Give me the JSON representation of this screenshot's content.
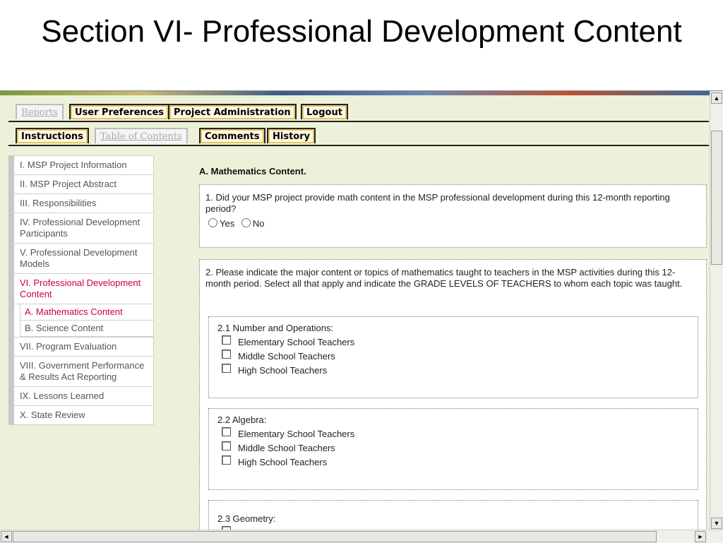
{
  "slide_title": "Section VI- Professional Development Content",
  "top_tabs": [
    {
      "label": "Reports",
      "state": "disabled"
    },
    {
      "label": "User Preferences",
      "state": "normal"
    },
    {
      "label": "Project Administration",
      "state": "normal"
    },
    {
      "label": "Logout",
      "state": "normal"
    }
  ],
  "sub_tabs": [
    {
      "label": "Instructions",
      "state": "normal"
    },
    {
      "label": "Table of Contents",
      "state": "disabled"
    },
    {
      "label": "Comments",
      "state": "normal"
    },
    {
      "label": "History",
      "state": "normal"
    }
  ],
  "nav": {
    "items": [
      {
        "label": "I. MSP Project Information"
      },
      {
        "label": "II. MSP Project Abstract"
      },
      {
        "label": "III. Responsibilities"
      },
      {
        "label": "IV. Professional Development Participants"
      },
      {
        "label": "V. Professional Development Models"
      },
      {
        "label": "VI. Professional Development Content",
        "active": true
      },
      {
        "label": "VII. Program Evaluation"
      },
      {
        "label": "VIII. Government Performance & Results Act Reporting"
      },
      {
        "label": "IX. Lessons Learned"
      },
      {
        "label": "X. State Review"
      }
    ],
    "subitems": [
      {
        "label": "A. Mathematics Content",
        "active": true
      },
      {
        "label": "B. Science Content"
      }
    ]
  },
  "main": {
    "section_heading": "A.   Mathematics Content.",
    "q1": {
      "text": "1. Did your MSP project provide math content in the MSP professional development during this 12-month reporting period?",
      "options": [
        "Yes",
        "No"
      ]
    },
    "q2": {
      "text": "2. Please indicate the major content or topics of mathematics taught to teachers in the MSP activities during this 12-month period. Select all that apply and indicate the GRADE LEVELS OF TEACHERS to whom each topic was taught.",
      "subsections": [
        {
          "title": "2.1 Number and Operations:",
          "options": [
            "Elementary School Teachers",
            "Middle School Teachers",
            "High School Teachers"
          ]
        },
        {
          "title": "2.2 Algebra:",
          "options": [
            "Elementary School Teachers",
            "Middle School Teachers",
            "High School Teachers"
          ]
        },
        {
          "title": "2.3 Geometry:",
          "options": []
        }
      ]
    }
  },
  "colors": {
    "page_bg": "#eef1d9",
    "tab_fill": "#fff8e0",
    "tab_accent": "#e6c46a",
    "active_nav": "#cc0033"
  }
}
